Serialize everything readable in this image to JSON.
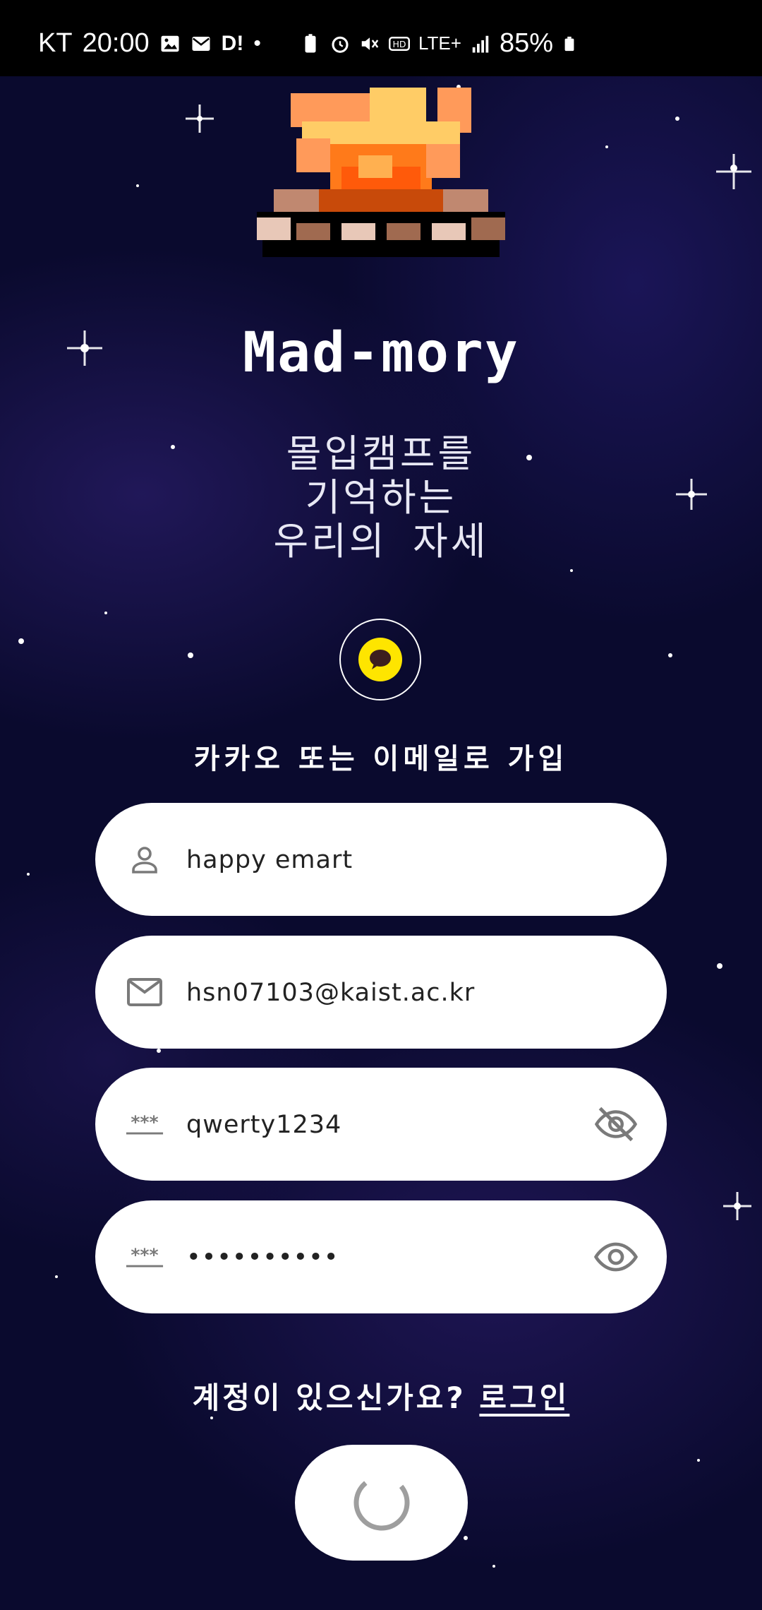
{
  "status_bar": {
    "carrier": "KT",
    "time": "20:00",
    "dot": "D!",
    "network": "LTE+",
    "battery": "85%"
  },
  "app": {
    "title": "Mad-mory",
    "tagline_lines": [
      "몰입캠프를",
      "기억하는",
      "우리의 자세"
    ]
  },
  "signup": {
    "label": "카카오 또는 이메일로 가입",
    "name_value": "happy emart",
    "email_value": "hsn07103@kaist.ac.kr",
    "password_value": "qwerty1234",
    "confirm_value": "••••••••••",
    "password_mask_label": "***"
  },
  "login_prompt": {
    "text": "계정이 있으신가요? ",
    "link": "로그인"
  },
  "icons": {
    "name": "person-icon",
    "email": "mail-icon",
    "password": "password-icon",
    "visibility_off": "eye-off-icon",
    "visibility_on": "eye-icon",
    "kakao": "kakao-talk-icon",
    "spinner": "loading-spinner-icon"
  },
  "colors": {
    "background": "#0a0a2e",
    "kakao_yellow": "#fee500",
    "field_bg": "#ffffff",
    "icon_gray": "#7a7a7a"
  }
}
